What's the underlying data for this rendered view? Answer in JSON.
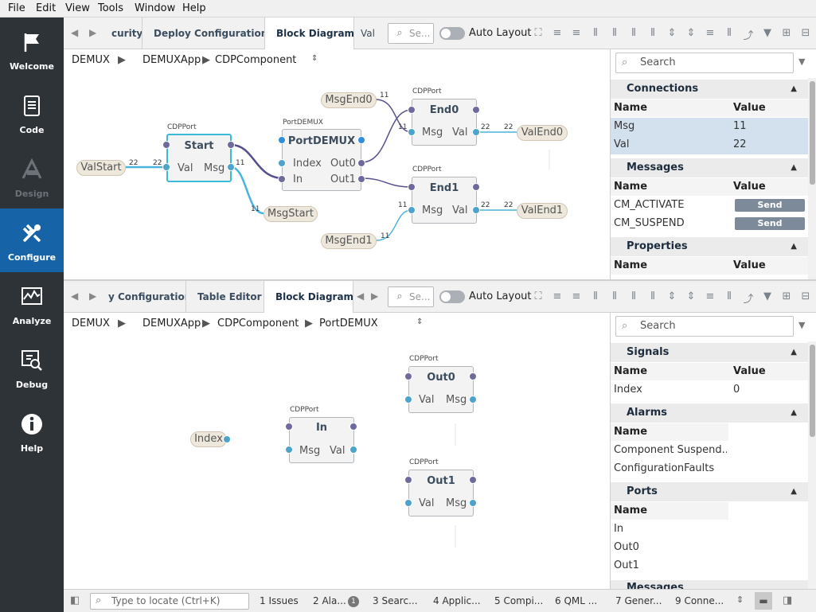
{
  "menu": [
    "File",
    "Edit",
    "View",
    "Tools",
    "Window",
    "Help"
  ],
  "modes": [
    {
      "label": "Welcome",
      "icon": "flag-icon",
      "state": "normal"
    },
    {
      "label": "Code",
      "icon": "document-icon",
      "state": "normal"
    },
    {
      "label": "Design",
      "icon": "design-icon",
      "state": "disabled"
    },
    {
      "label": "Configure",
      "icon": "tools-icon",
      "state": "active"
    },
    {
      "label": "Analyze",
      "icon": "chart-icon",
      "state": "normal"
    },
    {
      "label": "Debug",
      "icon": "debug-icon",
      "state": "normal"
    },
    {
      "label": "Help",
      "icon": "info-icon",
      "state": "normal"
    }
  ],
  "top": {
    "tabs": [
      "curity",
      "Deploy Configuration",
      "Block Diagram",
      "Val"
    ],
    "search_placeholder": "Se...",
    "auto_layout": "Auto Layout",
    "breadcrumb": [
      "DEMUX",
      "DEMUXApp",
      "CDPComponent"
    ],
    "panel": {
      "search": "Search",
      "connections": {
        "title": "Connections",
        "cols": [
          "Name",
          "Value"
        ],
        "rows": [
          [
            "Msg",
            "11"
          ],
          [
            "Val",
            "22"
          ]
        ]
      },
      "messages": {
        "title": "Messages",
        "cols": [
          "Name",
          "Value"
        ],
        "rows": [
          [
            "CM_ACTIVATE",
            "Send"
          ],
          [
            "CM_SUSPEND",
            "Send"
          ]
        ]
      },
      "properties": {
        "title": "Properties",
        "cols": [
          "Name",
          "Value"
        ]
      }
    },
    "diagram": {
      "blocks": {
        "start": {
          "title": "Start",
          "type": "CDPPort",
          "ports": [
            "Val",
            "Msg"
          ]
        },
        "demux": {
          "title": "PortDEMUX",
          "type": "PortDEMUX",
          "ports": [
            "Index",
            "In",
            "Out0",
            "Out1"
          ]
        },
        "end0": {
          "title": "End0",
          "type": "CDPPort",
          "ports": [
            "Msg",
            "Val"
          ]
        },
        "end1": {
          "title": "End1",
          "type": "CDPPort",
          "ports": [
            "Msg",
            "Val"
          ]
        }
      },
      "pills": [
        "ValStart",
        "MsgEnd0",
        "ValEnd0",
        "MsgStart",
        "MsgEnd1",
        "ValEnd1"
      ],
      "wire_labels": [
        "22",
        "22",
        "11",
        "11",
        "11",
        "11",
        "22",
        "22",
        "11",
        "11",
        "22",
        "22"
      ]
    }
  },
  "bottom": {
    "tabs": [
      "y Configuration",
      "Table Editor",
      "Block Diagram"
    ],
    "search_placeholder": "Se...",
    "auto_layout": "Auto Layout",
    "breadcrumb": [
      "DEMUX",
      "DEMUXApp",
      "CDPComponent",
      "PortDEMUX"
    ],
    "panel": {
      "search": "Search",
      "signals": {
        "title": "Signals",
        "cols": [
          "Name",
          "Value"
        ],
        "rows": [
          [
            "Index",
            "0"
          ]
        ]
      },
      "alarms": {
        "title": "Alarms",
        "cols": [
          "Name"
        ],
        "rows": [
          "Component Suspend...",
          "ConfigurationFaults"
        ]
      },
      "ports": {
        "title": "Ports",
        "cols": [
          "Name"
        ],
        "rows": [
          "In",
          "Out0",
          "Out1"
        ]
      },
      "messages": {
        "title": "Messages"
      }
    },
    "diagram": {
      "blocks": {
        "in": {
          "title": "In",
          "type": "CDPPort",
          "ports": [
            "Msg",
            "Val"
          ]
        },
        "out0": {
          "title": "Out0",
          "type": "CDPPort",
          "ports": [
            "Val",
            "Msg"
          ]
        },
        "out1": {
          "title": "Out1",
          "type": "CDPPort",
          "ports": [
            "Val",
            "Msg"
          ]
        }
      },
      "pills": [
        "Index"
      ]
    }
  },
  "status": {
    "locate_placeholder": "Type to locate (Ctrl+K)",
    "items": [
      "1  Issues",
      "2  Ala...",
      "3  Searc...",
      "4  Applic...",
      "5  Compi...",
      "6  QML ...",
      "7  Gener...",
      "9  Conne..."
    ],
    "issues_badge": "1"
  },
  "colors": {
    "sidebar": "#2e3338",
    "active_mode": "#1664a7",
    "selected_block": "#3cbbd9",
    "wire_purple": "#55508e",
    "wire_cyan": "#4ab4dd"
  }
}
